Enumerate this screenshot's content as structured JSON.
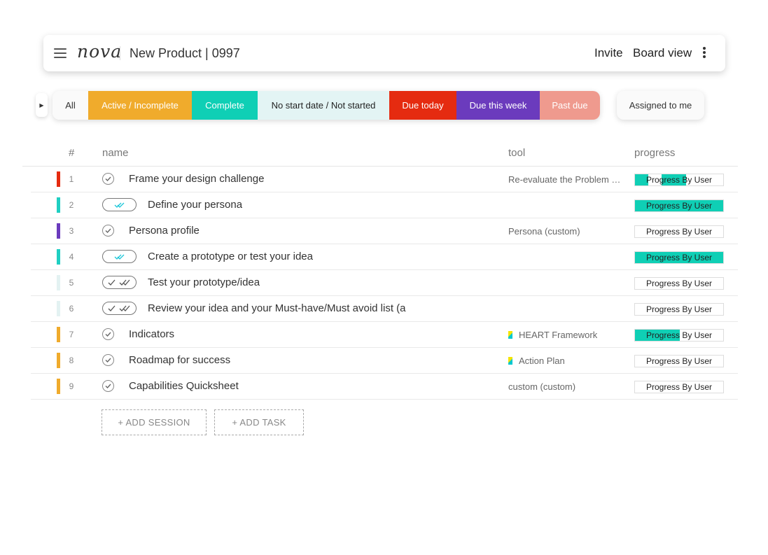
{
  "header": {
    "logo": "nova",
    "project_title": "New Product | 0997",
    "invite_label": "Invite",
    "board_view_label": "Board view"
  },
  "filters": {
    "items": [
      {
        "label": "All",
        "color": "#fafafa"
      },
      {
        "label": "Active / Incomplete",
        "color": "#f0ab2c"
      },
      {
        "label": "Complete",
        "color": "#0fcfb5"
      },
      {
        "label": "No start date / Not started",
        "color": "#e3f4f4"
      },
      {
        "label": "Due today",
        "color": "#e52b10"
      },
      {
        "label": "Due this week",
        "color": "#6b3bbd"
      },
      {
        "label": "Past due",
        "color": "#ef9a8e"
      }
    ],
    "assigned_label": "Assigned to me"
  },
  "table": {
    "headers": {
      "num": "#",
      "name": "name",
      "tool": "tool",
      "progress": "progress"
    },
    "rows": [
      {
        "num": "1",
        "kind": "check",
        "name": "Frame your design challenge",
        "tool": "Re-evaluate the Problem …",
        "tool_icon": false,
        "stripe": "#e52b10",
        "progress_label": "Progress By User",
        "progress_fill": "partial-split"
      },
      {
        "num": "2",
        "kind": "pill-done",
        "name": "Define your persona",
        "tool": "",
        "tool_icon": false,
        "stripe": "#1fcfc2",
        "progress_label": "Progress By User",
        "progress_fill": "full"
      },
      {
        "num": "3",
        "kind": "check",
        "name": "Persona profile",
        "tool": "Persona (custom)",
        "tool_icon": false,
        "stripe": "#6b3bbd",
        "progress_label": "Progress By User",
        "progress_fill": "none"
      },
      {
        "num": "4",
        "kind": "pill-done",
        "name": "Create a prototype or test your idea",
        "tool": "",
        "tool_icon": false,
        "stripe": "#1fcfc2",
        "progress_label": "Progress By User",
        "progress_fill": "full"
      },
      {
        "num": "5",
        "kind": "pill",
        "name": "Test your prototype/idea",
        "tool": "",
        "tool_icon": false,
        "stripe": "#e3f2f2",
        "progress_label": "Progress By User",
        "progress_fill": "none"
      },
      {
        "num": "6",
        "kind": "pill",
        "name": "Review your idea and your Must-have/Must avoid list (a",
        "tool": "",
        "tool_icon": false,
        "stripe": "#e3f2f2",
        "progress_label": "Progress By User",
        "progress_fill": "none"
      },
      {
        "num": "7",
        "kind": "check",
        "name": "Indicators",
        "tool": "HEART Framework",
        "tool_icon": true,
        "stripe": "#f0ab2c",
        "progress_label": "Progress By User",
        "progress_fill": "half"
      },
      {
        "num": "8",
        "kind": "check",
        "name": "Roadmap for success",
        "tool": "Action Plan",
        "tool_icon": true,
        "stripe": "#f0ab2c",
        "progress_label": "Progress By User",
        "progress_fill": "none"
      },
      {
        "num": "9",
        "kind": "check",
        "name": "Capabilities Quicksheet",
        "tool": "custom (custom)",
        "tool_icon": false,
        "stripe": "#f0ab2c",
        "progress_label": "Progress By User",
        "progress_fill": "none"
      }
    ]
  },
  "actions": {
    "add_session_label": "+ ADD SESSION",
    "add_task_label": "+ ADD TASK"
  }
}
